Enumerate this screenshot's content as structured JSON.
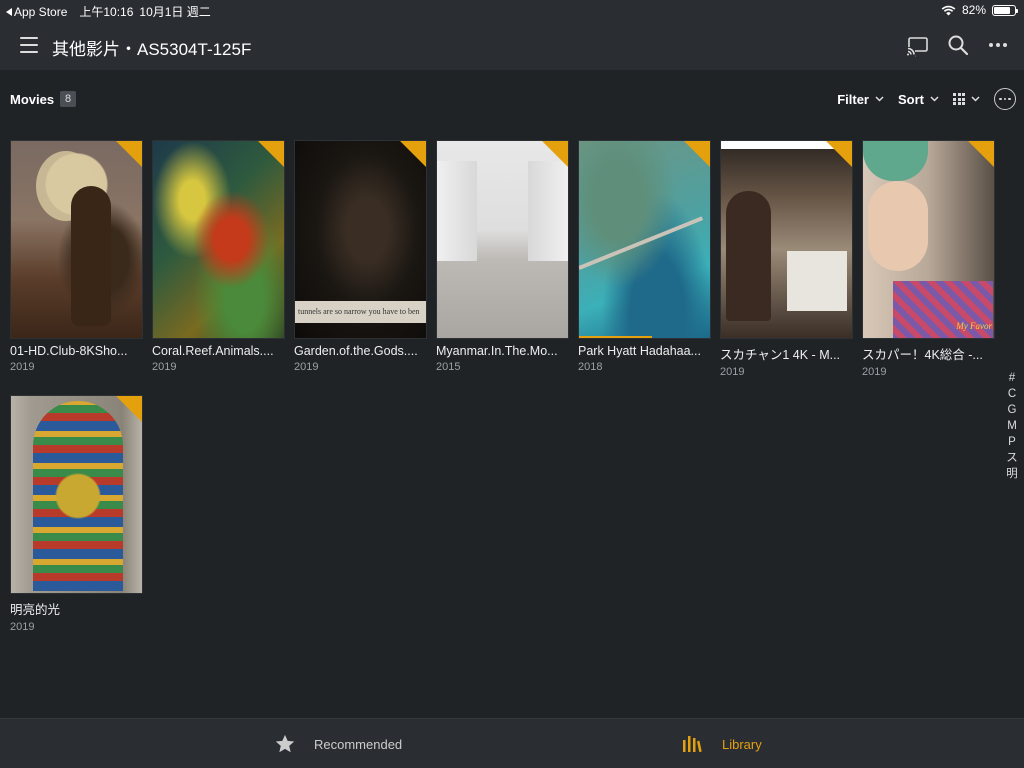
{
  "status_bar": {
    "back_app": "App Store",
    "time": "上午10:16",
    "date": "10月1日 週二",
    "battery": "82%",
    "battery_level": 0.82
  },
  "header": {
    "title": "其他影片・AS5304T-125F",
    "icons": [
      "menu-icon",
      "cast-icon",
      "search-icon",
      "more-icon"
    ]
  },
  "section": {
    "title": "Movies",
    "count": "8"
  },
  "controls": {
    "filter_label": "Filter",
    "sort_label": "Sort"
  },
  "items": [
    {
      "title": "01-HD.Club-8KSho...",
      "year": "2019"
    },
    {
      "title": "Coral.Reef.Animals....",
      "year": "2019"
    },
    {
      "title": "Garden.of.the.Gods....",
      "year": "2019",
      "subtitle_text": "tunnels are so narrow you have to ben"
    },
    {
      "title": "Myanmar.In.The.Mo...",
      "year": "2015"
    },
    {
      "title": "Park Hyatt Hadahaa...",
      "year": "2018",
      "progress": 0.56
    },
    {
      "title": "スカチャン1 4K - M...",
      "year": "2019"
    },
    {
      "title": "スカパー！4K総合 -...",
      "year": "2019",
      "overlay_text": "My Favor"
    },
    {
      "title": "明亮的光",
      "year": "2019"
    }
  ],
  "alpha_index": [
    "#",
    "C",
    "G",
    "M",
    "P",
    "ス",
    "明"
  ],
  "tabs": {
    "recommended": "Recommended",
    "library": "Library"
  },
  "colors": {
    "accent": "#e5a00d",
    "background": "#1f2326",
    "bar": "#2a2e33"
  }
}
